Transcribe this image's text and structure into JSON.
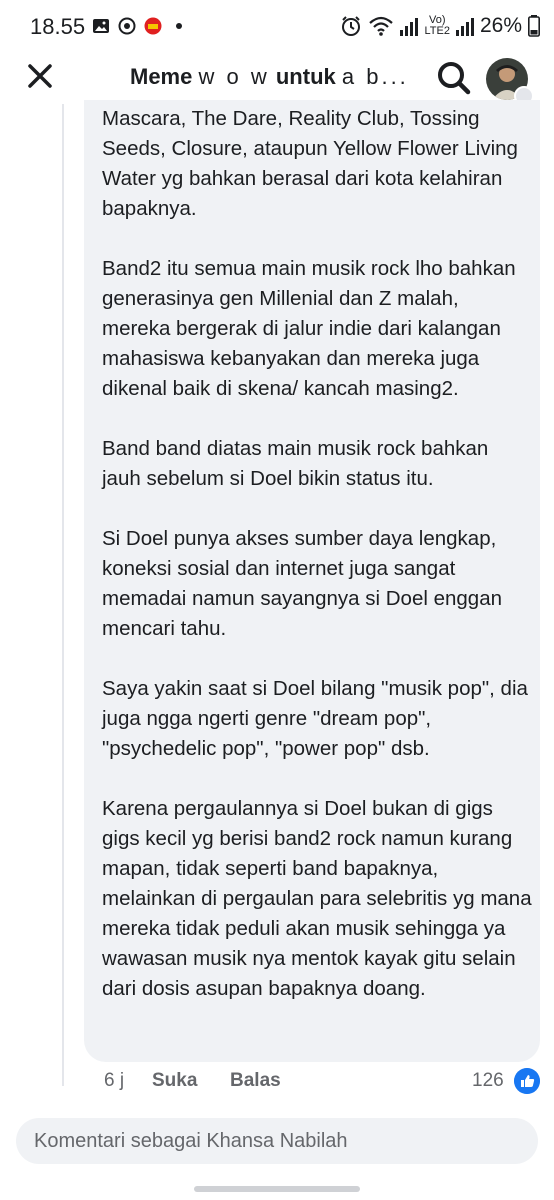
{
  "status_bar": {
    "time": "18.55",
    "network_label": "Vo)",
    "network_sub": "LTE2",
    "battery": "26%"
  },
  "header": {
    "title_bold_1": "Meme",
    "title_light_1": "w o w",
    "title_bold_2": "untuk",
    "title_light_2": "a b..."
  },
  "comment": {
    "paragraphs": [
      "Mascara, The Dare, Reality Club, Tossing Seeds, Closure, ataupun Yellow Flower Living Water yg bahkan berasal dari kota kelahiran bapaknya.",
      "Band2 itu semua main musik rock lho bahkan generasinya gen Millenial dan Z malah, mereka bergerak di jalur indie dari kalangan mahasiswa kebanyakan dan mereka juga dikenal baik di skena/ kancah masing2.",
      "Band band diatas main musik rock bahkan jauh sebelum si Doel bikin status itu.",
      "Si Doel punya akses sumber daya lengkap, koneksi sosial dan internet juga sangat memadai namun sayangnya si Doel enggan mencari tahu.",
      "Saya yakin saat si Doel bilang \"musik pop\", dia juga ngga ngerti genre \"dream pop\", \"psychedelic pop\", \"power pop\" dsb.",
      "Karena pergaulannya si Doel bukan di gigs gigs kecil yg berisi band2 rock namun kurang mapan, tidak seperti band bapaknya, melainkan di pergaulan para selebritis yg mana mereka tidak peduli akan musik sehingga ya wawasan musik nya mentok kayak gitu selain dari dosis asupan bapaknya doang."
    ],
    "time": "6 j",
    "like_label": "Suka",
    "reply_label": "Balas",
    "reaction_count": "126"
  },
  "composer": {
    "placeholder": "Komentari sebagai Khansa Nabilah"
  },
  "colors": {
    "accent": "#1877f2",
    "bubble": "#f0f2f5",
    "secondary_text": "#65676b"
  },
  "icons": [
    "gallery-icon",
    "cast-icon",
    "app-notification-icon",
    "alarm-icon",
    "wifi-icon",
    "signal-icon",
    "battery-icon",
    "close-icon",
    "search-icon",
    "like-icon"
  ]
}
